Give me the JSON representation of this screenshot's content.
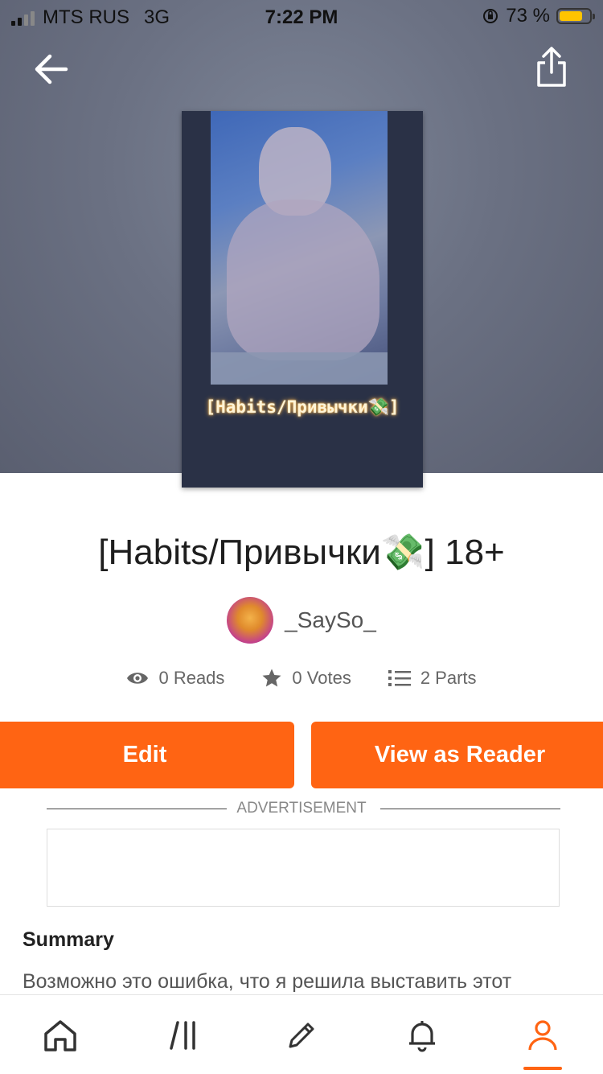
{
  "status_bar": {
    "carrier": "MTS RUS",
    "network": "3G",
    "time": "7:22 PM",
    "battery_percent": "73 %",
    "battery_level": 0.73
  },
  "header": {
    "back_icon": "arrow-left-icon",
    "share_icon": "share-icon"
  },
  "story": {
    "cover_text": "[Habits/Привычки💸]",
    "title": "[Habits/Привычки💸] 18+",
    "author": "_SaySo_"
  },
  "stats": {
    "reads": "0 Reads",
    "votes": "0 Votes",
    "parts": "2 Parts"
  },
  "actions": {
    "edit": "Edit",
    "view_as_reader": "View as Reader"
  },
  "ad": {
    "label": "ADVERTISEMENT"
  },
  "summary": {
    "heading": "Summary",
    "text": "Возможно это ошибка, что я решила выставить этот"
  },
  "tabbar": {
    "items": [
      "home-icon",
      "library-icon",
      "write-icon",
      "notifications-icon",
      "profile-icon"
    ],
    "active": "profile-icon"
  },
  "colors": {
    "accent": "#ff6413"
  }
}
